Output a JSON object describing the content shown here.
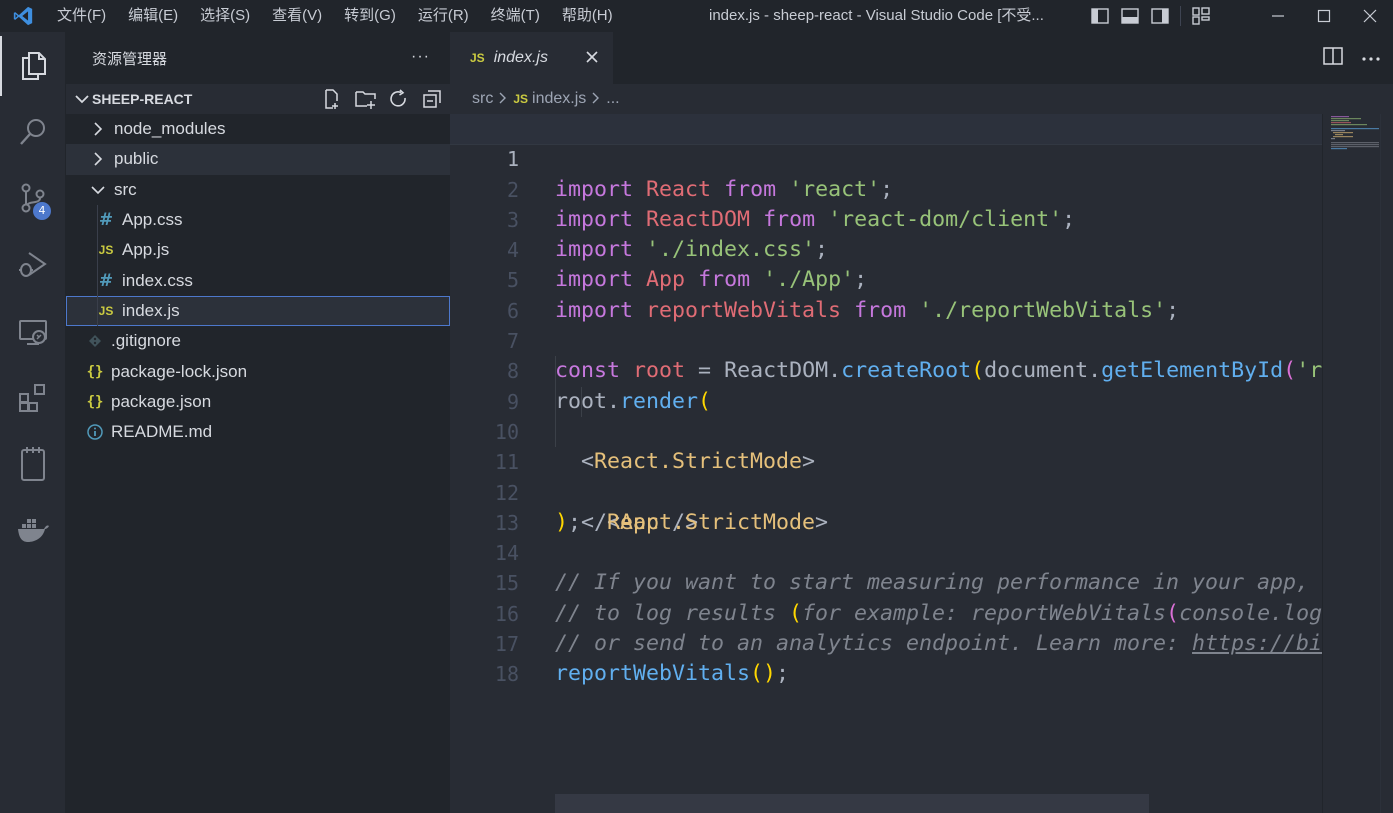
{
  "titlebar": {
    "menus": [
      "文件(F)",
      "编辑(E)",
      "选择(S)",
      "查看(V)",
      "转到(G)",
      "运行(R)",
      "终端(T)",
      "帮助(H)"
    ],
    "title": "index.js - sheep-react - Visual Studio Code [不受..."
  },
  "activity": {
    "scm_badge": "4"
  },
  "sidebar": {
    "header": "资源管理器",
    "more": "···",
    "project": "SHEEP-REACT",
    "tree": [
      {
        "label": "node_modules",
        "type": "folder",
        "expanded": false
      },
      {
        "label": "public",
        "type": "folder",
        "expanded": false
      },
      {
        "label": "src",
        "type": "folder",
        "expanded": true
      },
      {
        "label": "App.css",
        "type": "css"
      },
      {
        "label": "App.js",
        "type": "js"
      },
      {
        "label": "index.css",
        "type": "css"
      },
      {
        "label": "index.js",
        "type": "js",
        "selected": true
      },
      {
        "label": ".gitignore",
        "type": "git"
      },
      {
        "label": "package-lock.json",
        "type": "json"
      },
      {
        "label": "package.json",
        "type": "json"
      },
      {
        "label": "README.md",
        "type": "info"
      }
    ],
    "icons": {
      "css": "#",
      "js": "JS",
      "json": "{}"
    }
  },
  "editor": {
    "tab": {
      "icon": "JS",
      "label": "index.js"
    },
    "breadcrumb": {
      "folder": "src",
      "icon": "JS",
      "file": "index.js",
      "ellipsis": "..."
    },
    "line_numbers": [
      "1",
      "2",
      "3",
      "4",
      "5",
      "6",
      "7",
      "8",
      "9",
      "10",
      "11",
      "12",
      "13",
      "14",
      "15",
      "16",
      "17",
      "18"
    ],
    "code": {
      "import": "import",
      "from": "from",
      "const": "const",
      "l1_name": "React",
      "l1_src": "'react'",
      "l2_name": "ReactDOM",
      "l2_src": "'react-dom/client'",
      "l3_src": "'./index.css'",
      "l4_name": "App",
      "l4_src": "'./App'",
      "l5_name": "reportWebVitals",
      "l5_src": "'./reportWebVitals'",
      "l7_root": "root",
      "l7_obj": "ReactDOM",
      "l7_fn": "createRoot",
      "l7_doc": "document",
      "l7_fn2": "getElementById",
      "l7_str": "'ro",
      "l8_root": "root",
      "l8_fn": "render",
      "l9_tag": "React.StrictMode",
      "l10_tag": "App",
      "l11_tag": "React.StrictMode",
      "l14": "// If you want to start measuring performance in your app, p",
      "l15a": "// to log results ",
      "l15b": "for example: reportWebVitals",
      "l15c": "console.log",
      "l16a": "// or send to an analytics endpoint. Learn more: ",
      "l16b": "https://bit",
      "l17_fn": "reportWebVitals"
    }
  }
}
